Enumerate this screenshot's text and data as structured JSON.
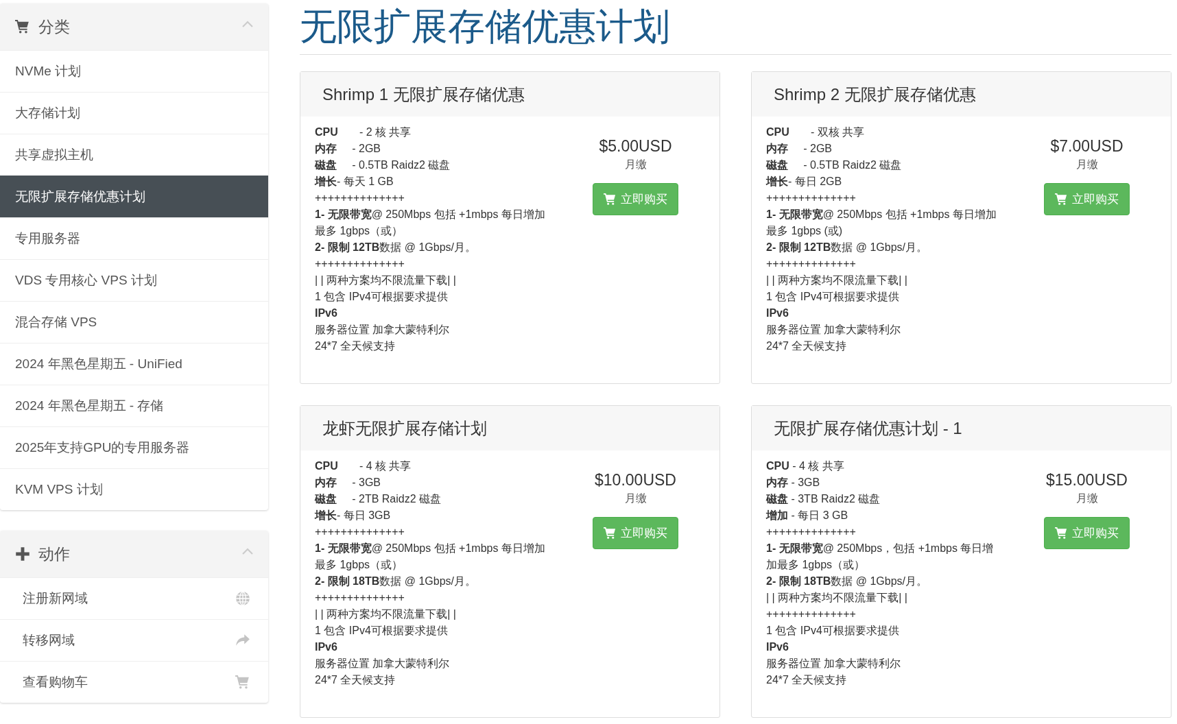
{
  "sidebar": {
    "panels": [
      {
        "kind": "categories",
        "title": "分类",
        "expanded": true,
        "items": [
          {
            "label": "NVMe 计划",
            "selected": false
          },
          {
            "label": "大存储计划",
            "selected": false
          },
          {
            "label": "共享虚拟主机",
            "selected": false
          },
          {
            "label": "无限扩展存储优惠计划",
            "selected": true
          },
          {
            "label": "专用服务器",
            "selected": false
          },
          {
            "label": "VDS 专用核心 VPS 计划",
            "selected": false
          },
          {
            "label": "混合存储 VPS",
            "selected": false
          },
          {
            "label": "2024 年黑色星期五 - UniFied",
            "selected": false
          },
          {
            "label": "2024 年黑色星期五 - 存储",
            "selected": false
          },
          {
            "label": "2025年支持GPU的专用服务器",
            "selected": false
          },
          {
            "label": "KVM VPS 计划",
            "selected": false
          }
        ]
      },
      {
        "kind": "actions",
        "title": "动作",
        "expanded": true,
        "items": [
          {
            "label": "注册新网域",
            "kind": "register"
          },
          {
            "label": "转移网域",
            "kind": "transfer"
          },
          {
            "label": "查看购物车",
            "kind": "cart"
          }
        ]
      }
    ]
  },
  "page_title": "无限扩展存储优惠计划",
  "products": [
    {
      "title": "Shrimp 1 无限扩展存储优惠",
      "price": "$5.00USD",
      "cycle": "月缴",
      "button": "立即购买",
      "lines": [
        "**CPU**       - 2 核 共享",
        "**内存**     - 2GB",
        "**磁盘**     - 0.5TB Raidz2 磁盘",
        "**增长**- 每天 1 GB",
        "++++++++++++++",
        "**1- 无限带宽**@ 250Mbps 包括 +1mbps 每日增加最多 1gbps（或）",
        "**2- 限制 12TB**数据 @ 1Gbps/月。",
        "++++++++++++++",
        "| | 两种方案均不限流量下载| |",
        "1 包含 IPv4可根据要求提供",
        "**IPv6**",
        "服务器位置 加拿大蒙特利尔",
        "24*7 全天候支持"
      ]
    },
    {
      "title": "Shrimp 2 无限扩展存储优惠",
      "price": "$7.00USD",
      "cycle": "月缴",
      "button": "立即购买",
      "lines": [
        "**CPU**       - 双核 共享",
        "**内存**     - 2GB",
        "**磁盘**     - 0.5TB Raidz2 磁盘",
        "**增长**- 每日 2GB",
        "++++++++++++++",
        "**1- 无限带宽**@ 250Mbps 包括 +1mbps 每日增加最多 1gbps (或)",
        "**2- 限制 12TB**数据 @ 1Gbps/月。",
        "++++++++++++++",
        "| | 两种方案均不限流量下载| |",
        "1 包含 IPv4可根据要求提供",
        "**IPv6**",
        "服务器位置 加拿大蒙特利尔",
        "24*7 全天候支持"
      ]
    },
    {
      "title": "龙虾无限扩展存储计划",
      "price": "$10.00USD",
      "cycle": "月缴",
      "button": "立即购买",
      "lines": [
        "**CPU**       - 4 核 共享",
        "**内存**     - 3GB",
        "**磁盘**     - 2TB Raidz2 磁盘",
        "**增长**- 每日 3GB",
        "++++++++++++++",
        "**1- 无限带宽**@ 250Mbps 包括 +1mbps 每日增加最多 1gbps（或）",
        "**2- 限制 18TB**数据 @ 1Gbps/月。",
        "++++++++++++++",
        "| | 两种方案均不限流量下载| |",
        "1 包含 IPv4可根据要求提供",
        "**IPv6**",
        "服务器位置 加拿大蒙特利尔",
        "24*7 全天候支持"
      ]
    },
    {
      "title": "无限扩展存储优惠计划 - 1",
      "price": "$15.00USD",
      "cycle": "月缴",
      "button": "立即购买",
      "lines": [
        "**CPU** - 4 核 共享",
        "**内存** - 3GB",
        "**磁盘** - 3TB Raidz2 磁盘",
        "**增加** - 每日 3 GB",
        "++++++++++++++",
        "**1- 无限带宽**@ 250Mbps，包括 +1mbps 每日增加最多 1gbps（或）",
        "**2- 限制 18TB**数据 @ 1Gbps/月。",
        "| | 两种方案均不限流量下载| |",
        "++++++++++++++",
        "1 包含 IPv4可根据要求提供",
        "**IPv6**",
        "服务器位置 加拿大蒙特利尔",
        "24*7 全天候支持"
      ]
    }
  ]
}
